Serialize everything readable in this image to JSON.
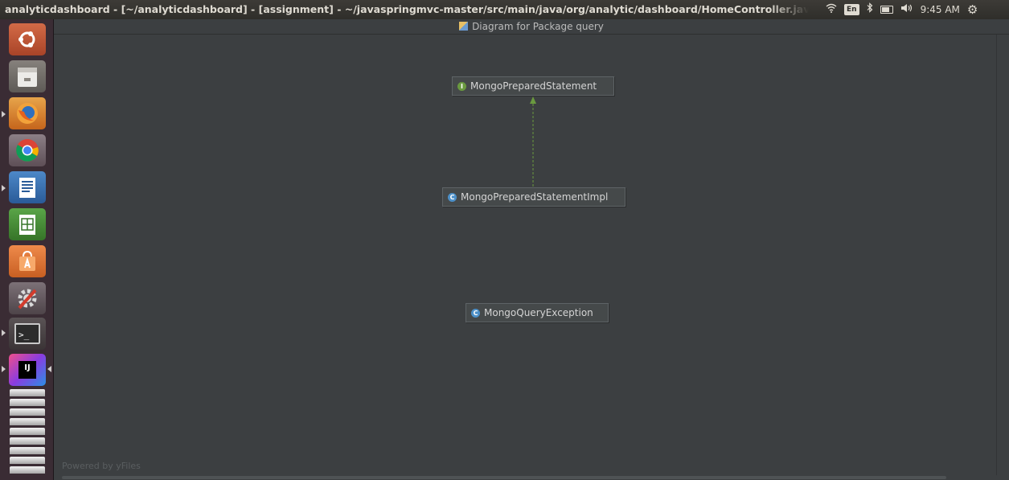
{
  "topbar": {
    "window_title": "analyticdashboard - [~/analyticdashboard] - [assignment] - ~/javaspringmvc-master/src/main/java/org/analytic/dashboard/HomeController.java - IntelliJ ID",
    "keyboard_layout": "En",
    "clock": "9:45 AM"
  },
  "launcher": {
    "items": [
      "ubuntu-dash",
      "files",
      "firefox",
      "chrome",
      "libreoffice-writer",
      "libreoffice-calc",
      "software-center",
      "system-settings",
      "terminal",
      "intellij-idea"
    ],
    "terminal_glyph": ">_",
    "intellij_glyph": "IJ"
  },
  "diagram": {
    "title": "Diagram for Package query",
    "nodes": [
      {
        "label": "MongoPreparedStatement",
        "kind": "interface",
        "badge": "I"
      },
      {
        "label": "MongoPreparedStatementImpl",
        "kind": "class",
        "badge": "C"
      },
      {
        "label": "MongoQueryException",
        "kind": "class",
        "badge": "C"
      }
    ],
    "edge_color": "#6a9a3f",
    "watermark": "Powered by yFiles"
  }
}
